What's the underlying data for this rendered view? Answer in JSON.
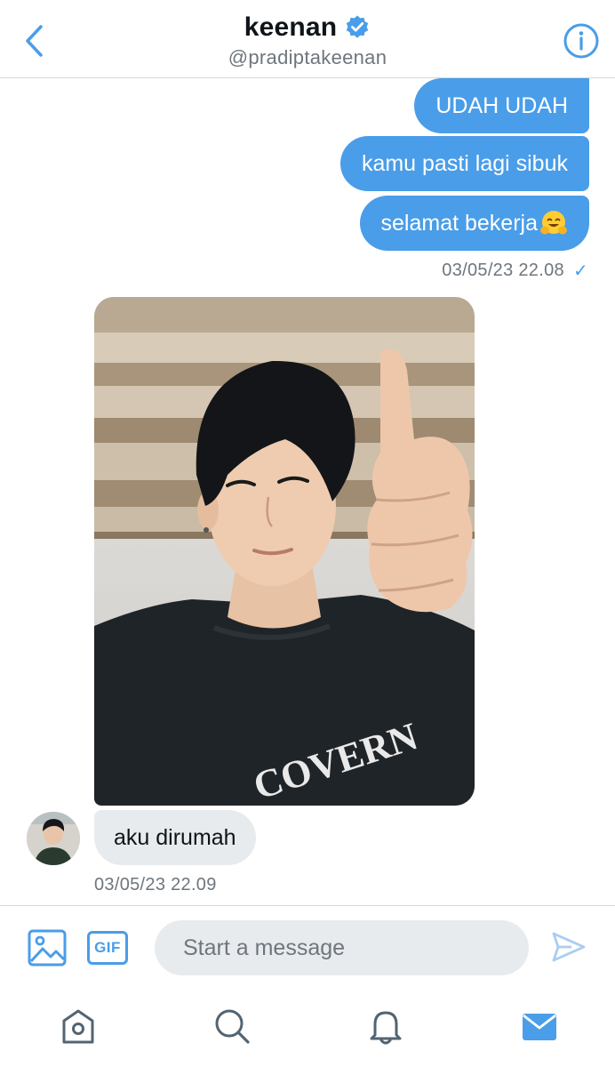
{
  "header": {
    "title": "keenan",
    "handle": "@pradiptakeenan"
  },
  "messages": {
    "sent": [
      {
        "text": "UDAH UDAH"
      },
      {
        "text": "kamu pasti lagi sibuk"
      },
      {
        "text": "selamat bekerja",
        "emoji": "hugging-face-emoji"
      }
    ],
    "sent_timestamp": "03/05/23 22.08",
    "sent_status": "✓",
    "received": [
      {
        "type": "photo",
        "description_icon": "selfie-photo"
      },
      {
        "text": "aku dirumah"
      }
    ],
    "received_timestamp": "03/05/23 22.09"
  },
  "composer": {
    "gif_label": "GIF",
    "placeholder": "Start a message"
  },
  "tabs": [
    "home",
    "search",
    "notifications",
    "messages"
  ],
  "colors": {
    "accent": "#4a9de8",
    "received_bubble": "#e8ebee",
    "meta_text": "#6e767d"
  }
}
